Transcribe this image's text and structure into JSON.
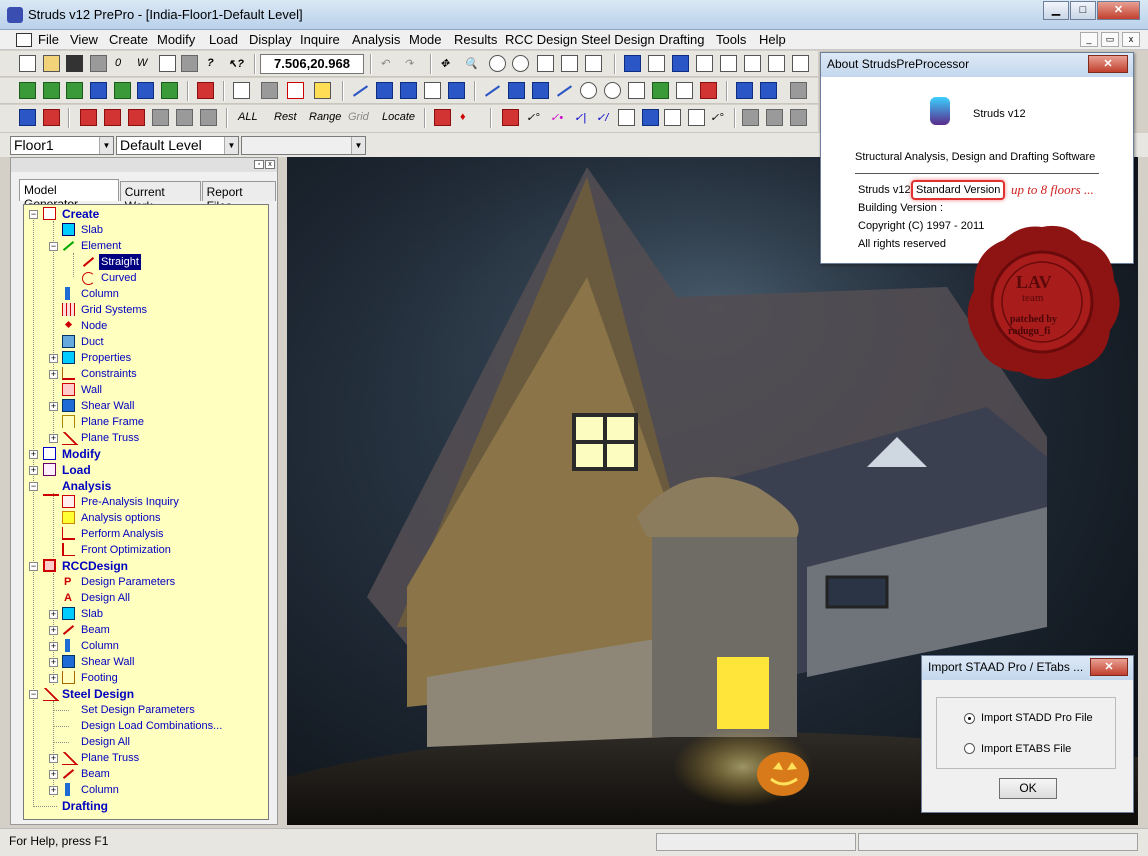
{
  "window": {
    "title": "Struds v12 PrePro - [India-Floor1-Default Level]",
    "btn_min": "▁",
    "btn_max": "□",
    "btn_close": "✕"
  },
  "menu": {
    "items": [
      "File",
      "View",
      "Create",
      "Modify",
      "Load",
      "Display",
      "Inquire",
      "Analysis",
      "Mode",
      "Results",
      "RCC Design",
      "Steel Design",
      "Drafting",
      "Tools",
      "Help"
    ]
  },
  "toolbar": {
    "coords": "7.506,20.968",
    "filter_labels": [
      "ALL",
      "Rest",
      "Range",
      "Grid",
      "Locate"
    ]
  },
  "selectors": {
    "floor": "Floor1",
    "level": "Default Level"
  },
  "panel": {
    "tabs": [
      "Model Generator",
      "Current Work",
      "Report Files"
    ]
  },
  "tree": {
    "create": "Create",
    "slab": "Slab",
    "element": "Element",
    "straight": "Straight",
    "curved": "Curved",
    "column": "Column",
    "grid_systems": "Grid Systems",
    "node": "Node",
    "duct": "Duct",
    "properties": "Properties",
    "constraints": "Constraints",
    "wall": "Wall",
    "shear_wall": "Shear Wall",
    "plane_frame": "Plane Frame",
    "plane_truss": "Plane Truss",
    "modify": "Modify",
    "load": "Load",
    "analysis": "Analysis",
    "pre_analysis": "Pre-Analysis Inquiry",
    "analysis_options": "Analysis options",
    "perform_analysis": "Perform Analysis",
    "front_opt": "Front Optimization",
    "rcc": "RCCDesign",
    "design_params": "Design Parameters",
    "design_all": "Design All",
    "rcc_slab": "Slab",
    "rcc_beam": "Beam",
    "rcc_column": "Column",
    "rcc_shear": "Shear Wall",
    "rcc_footing": "Footing",
    "steel": "Steel Design",
    "set_params": "Set Design Parameters",
    "load_combos": "Design Load Combinations...",
    "steel_design_all": "Design All",
    "steel_truss": "Plane Truss",
    "steel_beam": "Beam",
    "steel_column": "Column",
    "drafting": "Drafting"
  },
  "about": {
    "title": "About StrudsPreProcessor",
    "product": "Struds v12",
    "description": "Structural Analysis, Design and Drafting Software",
    "version_prefix": "Struds v12",
    "version": "Standard Version",
    "limit_note": "up to 8 floors ...",
    "building": "Building Version :",
    "copyright": "Copyright (C) 1997 - 2011",
    "rights": "All rights reserved",
    "close": "✕"
  },
  "seal": {
    "line1": "LAV",
    "line2": "team",
    "line3": "patched by",
    "line4": "radugu_fi"
  },
  "import": {
    "title": "Import STAAD Pro / ETabs ...",
    "opt1": "Import STADD Pro File",
    "opt2": "Import ETABS File",
    "selected": "Import STADD Pro File",
    "ok": "OK",
    "close": "✕"
  },
  "status": {
    "help": "For Help, press F1"
  },
  "colors": {
    "tree_bg": "#ffffc0",
    "tree_text": "#0000c0",
    "highlight": "#e03030"
  }
}
